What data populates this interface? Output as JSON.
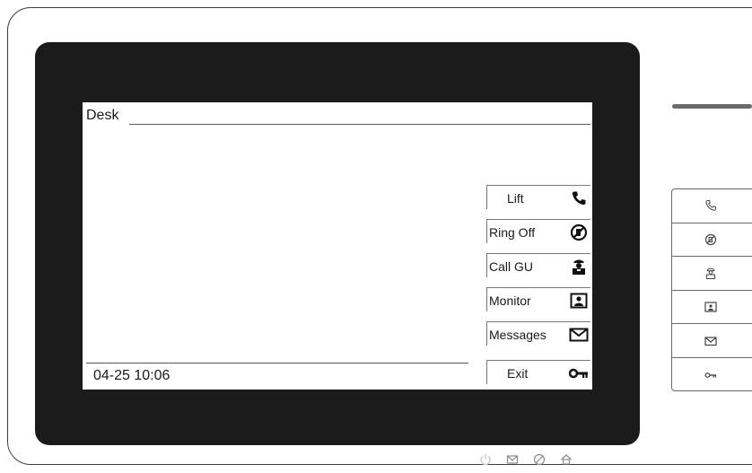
{
  "screen": {
    "title": "Desk",
    "datetime": "04-25 10:06"
  },
  "softkeys": [
    {
      "label": "Lift",
      "icon": "handset-icon"
    },
    {
      "label": "Ring Off",
      "icon": "ring-off-icon"
    },
    {
      "label": "Call GU",
      "icon": "guard-icon"
    },
    {
      "label": "Monitor",
      "icon": "monitor-icon"
    },
    {
      "label": "Messages",
      "icon": "envelope-icon"
    },
    {
      "label": "Exit",
      "icon": "key-icon"
    }
  ],
  "bezel_indicators": [
    "power-icon",
    "message-led-icon",
    "mute-led-icon",
    "home-icon"
  ],
  "side_buttons": [
    "handset-icon",
    "ring-off-icon",
    "guard-icon",
    "monitor-icon",
    "envelope-icon",
    "key-icon"
  ],
  "colors": {
    "bezel": "#1b1b1b",
    "screen": "#ffffff",
    "outline": "#3a3a3a"
  }
}
